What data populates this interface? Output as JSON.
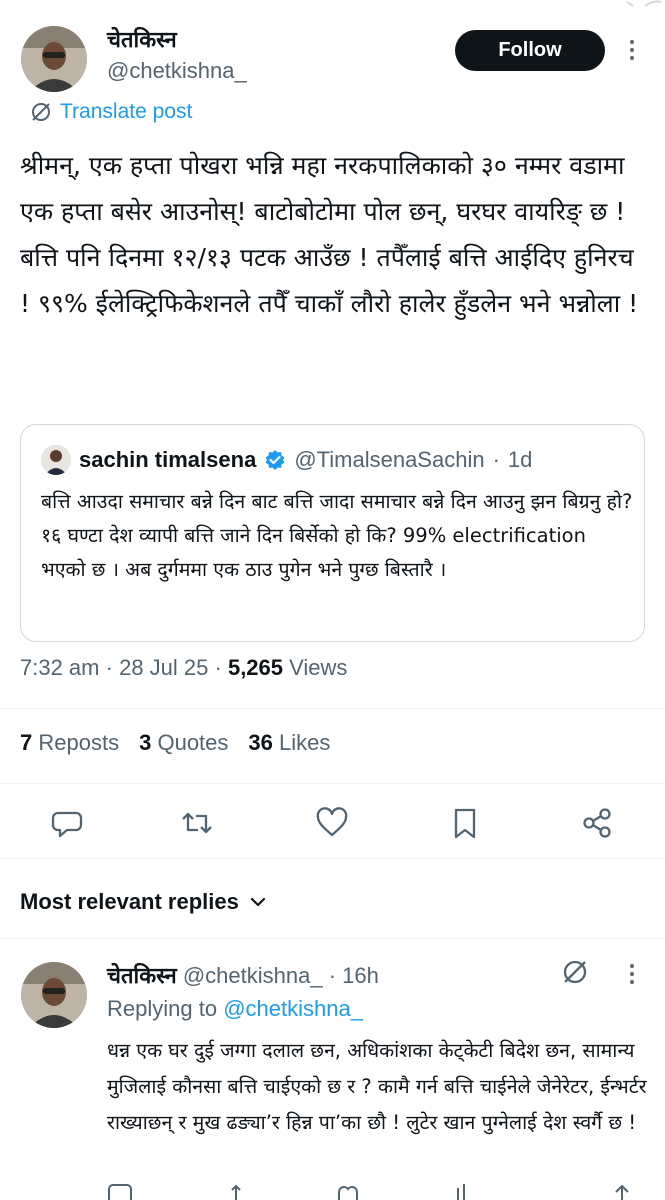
{
  "post": {
    "display_name": "चेतकिस्न",
    "handle": "@chetkishna_",
    "follow_label": "Follow",
    "translate_label": "Translate post",
    "text": "श्रीमन्, एक हप्ता पोखरा भन्नि महा नरकपालिकाको ३० नम्मर वडामा एक हप्ता बसेर आउनोस्! बाटोबोटोमा पोल छन्, घरघर वायरिङ् छ ! बत्ति पनि दिनमा १२/१३ पटक आउँछ ! तपैँलाई बत्ति आईदिए हुनिरच ! ९९% ईलेक्ट्रिफिकेशनले तपैँ चाकाँ लौरो हालेर हुँडलेन भने भन्नोला !",
    "time": "7:32 am",
    "date": "28 Jul 25",
    "views_count": "5,265",
    "views_label": "Views",
    "reposts_count": "7",
    "reposts_label": "Reposts",
    "quotes_count": "3",
    "quotes_label": "Quotes",
    "likes_count": "36",
    "likes_label": "Likes"
  },
  "quote": {
    "name": "sachin timalsena",
    "handle": "@TimalsenaSachin",
    "age": "1d",
    "text": "बत्ति आउदा समाचार बन्ने दिन बाट बत्ति जादा समाचार बन्ने दिन आउनु झन बिग्रनु हो? १६ घण्टा देश व्यापी बत्ति जाने दिन बिर्सेको हो कि? 99% electrification भएको छ । अब दुर्गममा एक ठाउ पुगेन भने पुग्छ बिस्तारै ।"
  },
  "replies_section": {
    "title": "Most relevant replies"
  },
  "reply": {
    "display_name": "चेतकिस्न",
    "handle": "@chetkishna_",
    "age": "16h",
    "replying_to_label": "Replying to",
    "replying_to_handle": "@chetkishna_",
    "text": "धन्न एक घर दुई जग्गा दलाल छन, अधिकांशका केट्केटी बिदेश छन, सामान्य मुजिलाई कौनसा बत्ति चाईएको छ र ? कामै गर्न बत्ति चाईनेले जेनेरेटर, ईन्भर्टर राख्याछन् र मुख ढङ्या’र हिन्न पा’का छौ ! लुटेर खान पुग्नेलाई देश स्वर्गै छ !"
  },
  "icons": {
    "translate": "translate-slash-icon",
    "verified": "verified-badge-icon",
    "reply": "reply-bubble-icon",
    "repost": "repost-icon",
    "like": "heart-icon",
    "bookmark": "bookmark-icon",
    "share": "share-icon",
    "chevron": "chevron-down-icon",
    "more": "more-vertical-icon"
  },
  "colors": {
    "accent": "#1d9bf0",
    "text": "#0f1419",
    "muted": "#536471",
    "border": "#cfd9de"
  }
}
